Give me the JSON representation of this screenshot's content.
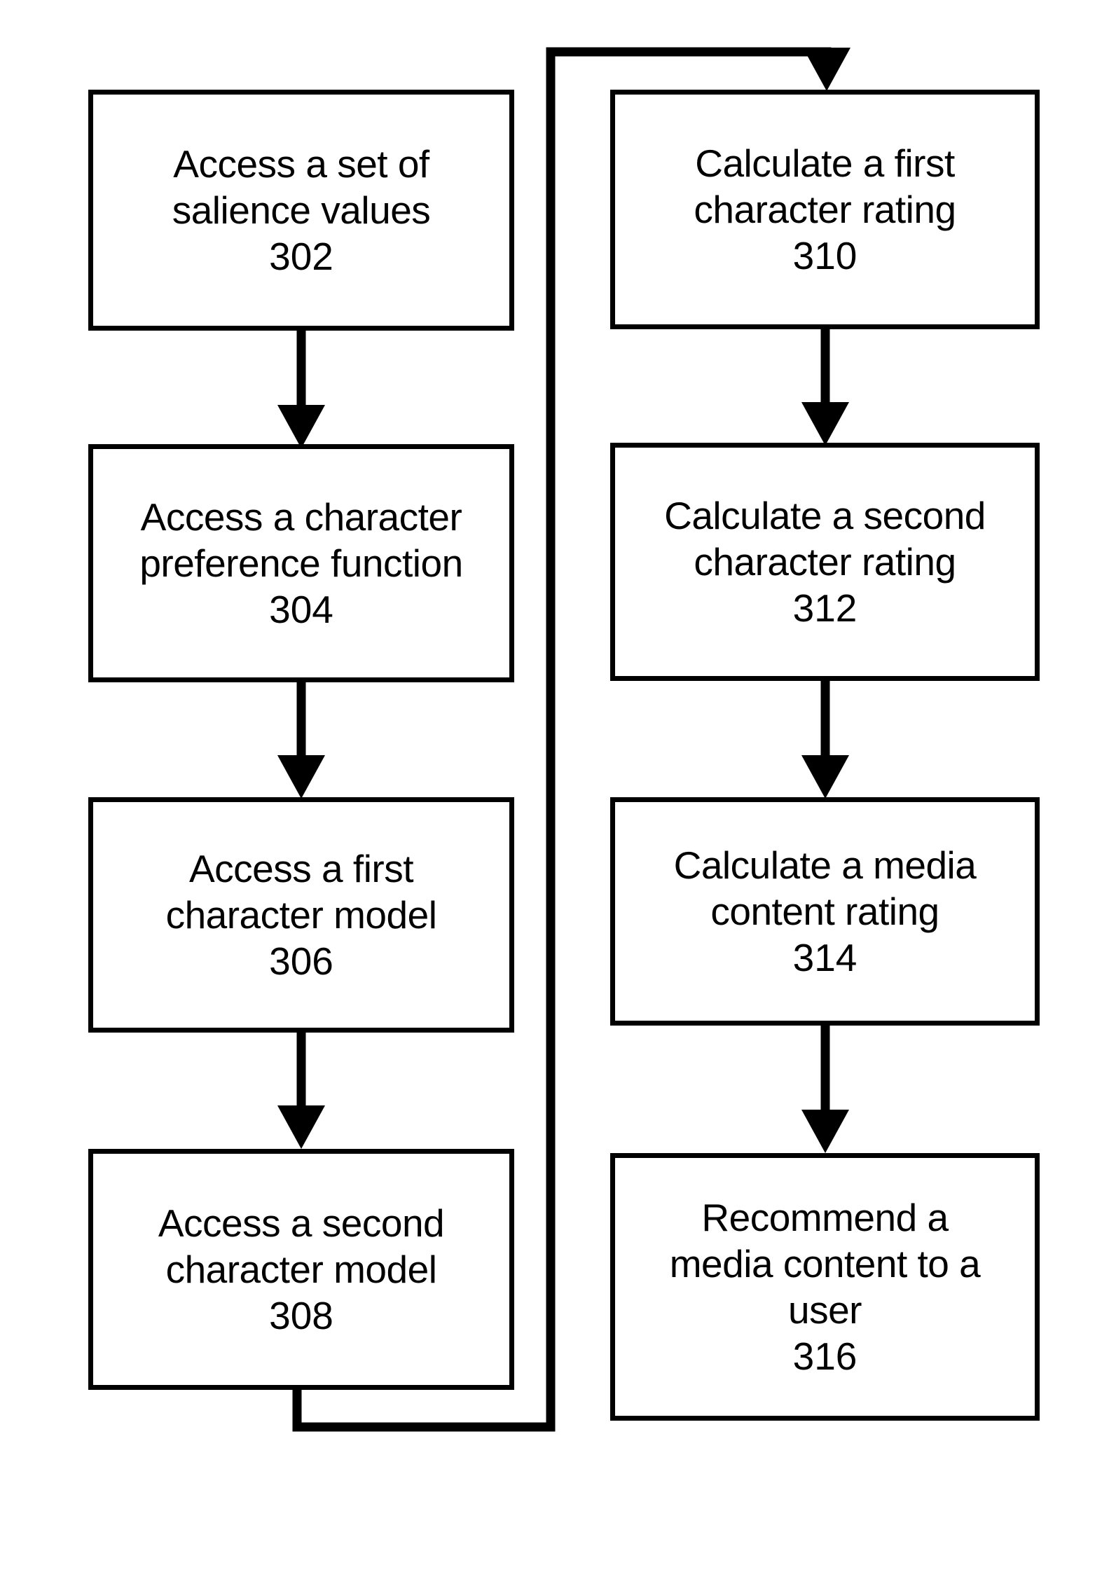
{
  "figure": {
    "type": "flowchart",
    "orientation": "two-column-with-feedback-loop",
    "background_color": "#ffffff",
    "line_color": "#000000",
    "stroke_width_px": 7
  },
  "nodes": [
    {
      "id": "302",
      "column": "left",
      "lines": [
        "Access a set of",
        "salience values"
      ],
      "ref": "302"
    },
    {
      "id": "304",
      "column": "left",
      "lines": [
        "Access a character",
        "preference function"
      ],
      "ref": "304"
    },
    {
      "id": "306",
      "column": "left",
      "lines": [
        "Access a first",
        "character model"
      ],
      "ref": "306"
    },
    {
      "id": "308",
      "column": "left",
      "lines": [
        "Access a second",
        "character model"
      ],
      "ref": "308"
    },
    {
      "id": "310",
      "column": "right",
      "lines": [
        "Calculate a first",
        "character rating"
      ],
      "ref": "310"
    },
    {
      "id": "312",
      "column": "right",
      "lines": [
        "Calculate a second",
        "character rating"
      ],
      "ref": "312"
    },
    {
      "id": "314",
      "column": "right",
      "lines": [
        "Calculate a media",
        "content rating"
      ],
      "ref": "314"
    },
    {
      "id": "316",
      "column": "right",
      "lines": [
        "Recommend a",
        "media content to a",
        "user"
      ],
      "ref": "316"
    }
  ],
  "edges": [
    {
      "from": "302",
      "to": "304",
      "kind": "arrow-down"
    },
    {
      "from": "304",
      "to": "306",
      "kind": "arrow-down"
    },
    {
      "from": "306",
      "to": "308",
      "kind": "arrow-down"
    },
    {
      "from": "308",
      "to": "310",
      "kind": "feedback-loop-arrow"
    },
    {
      "from": "310",
      "to": "312",
      "kind": "arrow-down"
    },
    {
      "from": "312",
      "to": "314",
      "kind": "arrow-down"
    },
    {
      "from": "314",
      "to": "316",
      "kind": "arrow-down"
    }
  ]
}
